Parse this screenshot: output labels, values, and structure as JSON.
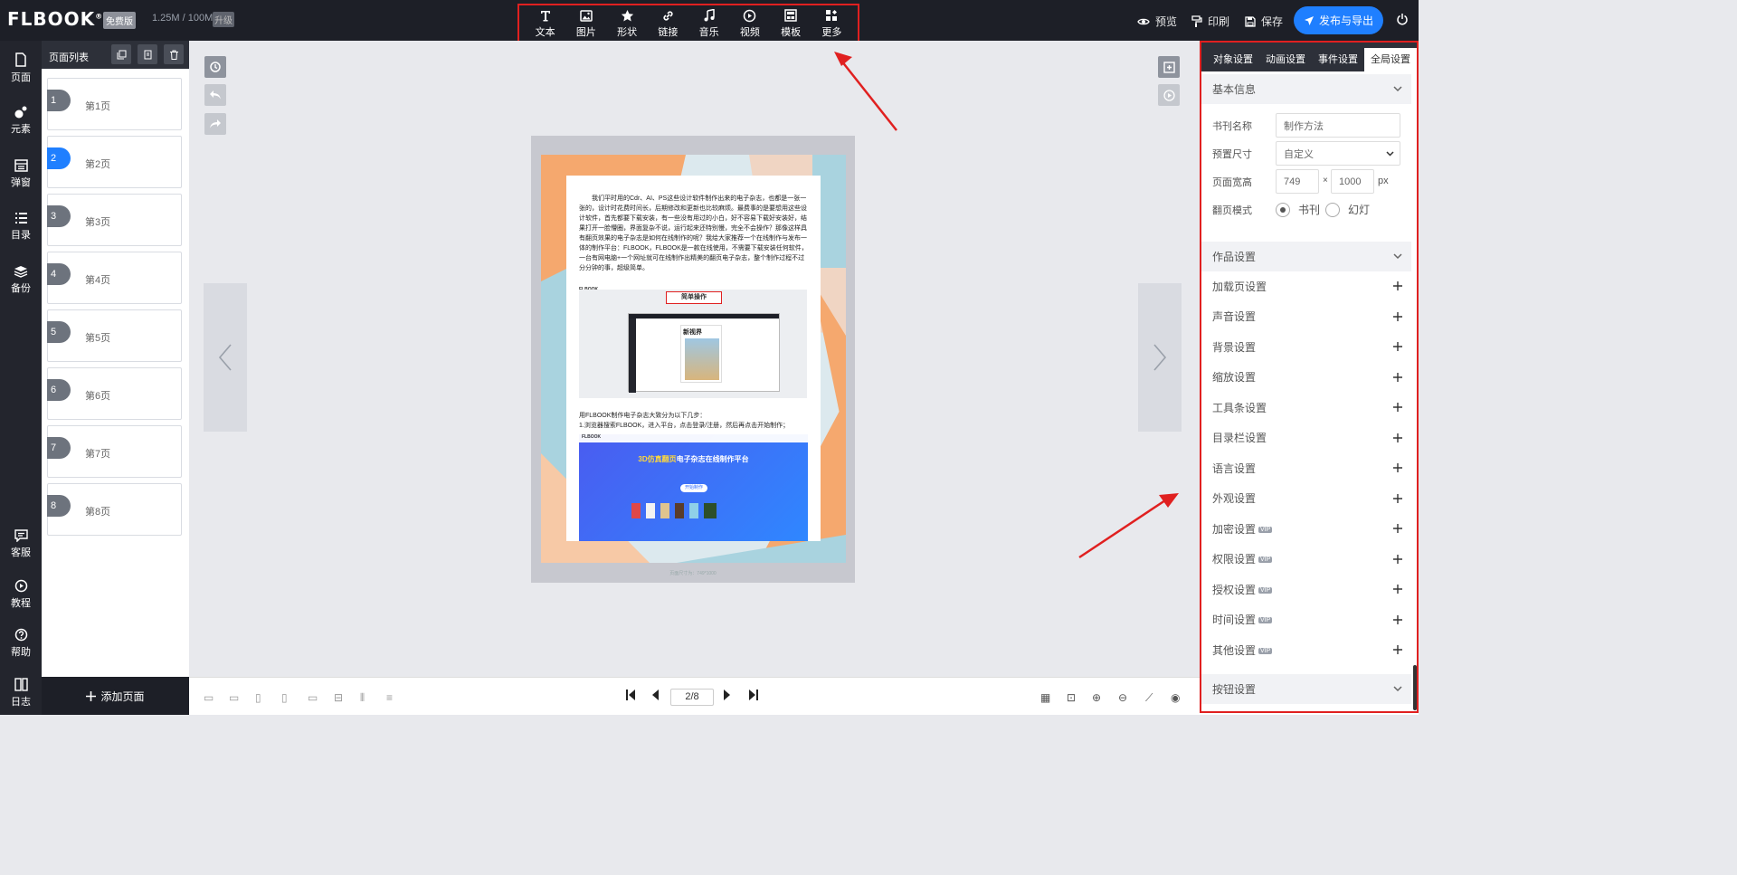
{
  "app": {
    "brand": "FLBOOK",
    "plan_badge": "免费版",
    "storage": "1.25M / 100M",
    "upgrade": "升级"
  },
  "toolbar": {
    "items": [
      {
        "label": "文本",
        "icon": "text-icon"
      },
      {
        "label": "图片",
        "icon": "image-icon"
      },
      {
        "label": "形状",
        "icon": "star-icon"
      },
      {
        "label": "链接",
        "icon": "link-icon"
      },
      {
        "label": "音乐",
        "icon": "music-icon"
      },
      {
        "label": "视频",
        "icon": "video-icon"
      },
      {
        "label": "模板",
        "icon": "template-icon"
      },
      {
        "label": "更多",
        "icon": "more-icon"
      }
    ],
    "preview": "预览",
    "print": "印刷",
    "save": "保存",
    "publish": "发布与导出"
  },
  "leftnav": {
    "items": [
      "页面",
      "元素",
      "弹窗",
      "目录",
      "备份"
    ],
    "bottom_items": [
      "客服",
      "教程",
      "帮助",
      "日志"
    ]
  },
  "pagepanel": {
    "title": "页面列表",
    "pages": [
      {
        "num": "1",
        "label": "第1页"
      },
      {
        "num": "2",
        "label": "第2页"
      },
      {
        "num": "3",
        "label": "第3页"
      },
      {
        "num": "4",
        "label": "第4页"
      },
      {
        "num": "5",
        "label": "第5页"
      },
      {
        "num": "6",
        "label": "第6页"
      },
      {
        "num": "7",
        "label": "第7页"
      },
      {
        "num": "8",
        "label": "第8页"
      }
    ],
    "active_page": 2,
    "add_page": "添加页面"
  },
  "canvas": {
    "paragraph": "我们平时用的Cdr、AI、PS这些设计软件制作出来的电子杂志，也都是一张一张的，设计时花费时间长，后期修改和更新也比较麻烦。最费事的是要想用这些设计软件，首先都要下载安装，有一些没有用过的小白，好不容易下载好安装好，结果打开一脸懵圈，界面复杂不说，运行起来还特别慢，完全不会操作？那像这样具有翻页效果的电子杂志是如何在线制作的呢？我给大家推荐一个在线制作与发布一体的制作平台：FLBOOK，FLBOOK是一款在线使用，不需要下载安装任何软件，一台有网电脑+一个网址就可在线制作出精美的翻页电子杂志，整个制作过程不过分分钟的事，超级简单。",
    "screenshot1_label": "简单操作",
    "screenshot1_logo": "FLBOOK",
    "mag_title": "新视界",
    "line1": "用FLBOOK制作电子杂志大致分为以下几步：",
    "line2": "1.浏览器搜索FLBOOK，进入平台，点击登录/注册，然后再点击开始制作；",
    "banner_title": "3D仿真翻页电子杂志在线制作平台",
    "banner_title_highlight": "3D仿真翻页",
    "banner_button": "开始制作",
    "page_size_note": "页面尺寸为：749*1000"
  },
  "bottombar": {
    "page_indicator": "2/8"
  },
  "rightpanel": {
    "tabs": [
      "对象设置",
      "动画设置",
      "事件设置",
      "全局设置"
    ],
    "active_tab": "全局设置",
    "basic_info": {
      "title": "基本信息",
      "name_label": "书刊名称",
      "name_value": "制作方法",
      "preset_label": "预置尺寸",
      "preset_value": "自定义",
      "size_label": "页面宽高",
      "width": "749",
      "height": "1000",
      "times": "×",
      "unit": "px",
      "mode_label": "翻页模式",
      "mode_book": "书刊",
      "mode_slide": "幻灯",
      "selected_mode": "书刊"
    },
    "works_settings": {
      "title": "作品设置",
      "items": [
        {
          "label": "加载页设置",
          "vip": false
        },
        {
          "label": "声音设置",
          "vip": false
        },
        {
          "label": "背景设置",
          "vip": false
        },
        {
          "label": "缩放设置",
          "vip": false
        },
        {
          "label": "工具条设置",
          "vip": false
        },
        {
          "label": "目录栏设置",
          "vip": false
        },
        {
          "label": "语言设置",
          "vip": false
        },
        {
          "label": "外观设置",
          "vip": false
        },
        {
          "label": "加密设置",
          "vip": true
        },
        {
          "label": "权限设置",
          "vip": true
        },
        {
          "label": "授权设置",
          "vip": true
        },
        {
          "label": "时间设置",
          "vip": true
        },
        {
          "label": "其他设置",
          "vip": true
        }
      ],
      "vip_text": "VIP"
    },
    "button_settings": {
      "title": "按钮设置"
    }
  },
  "colors": {
    "accent": "#1f7fff",
    "topbar": "#1d1f27",
    "highlight_box": "#e02020"
  }
}
